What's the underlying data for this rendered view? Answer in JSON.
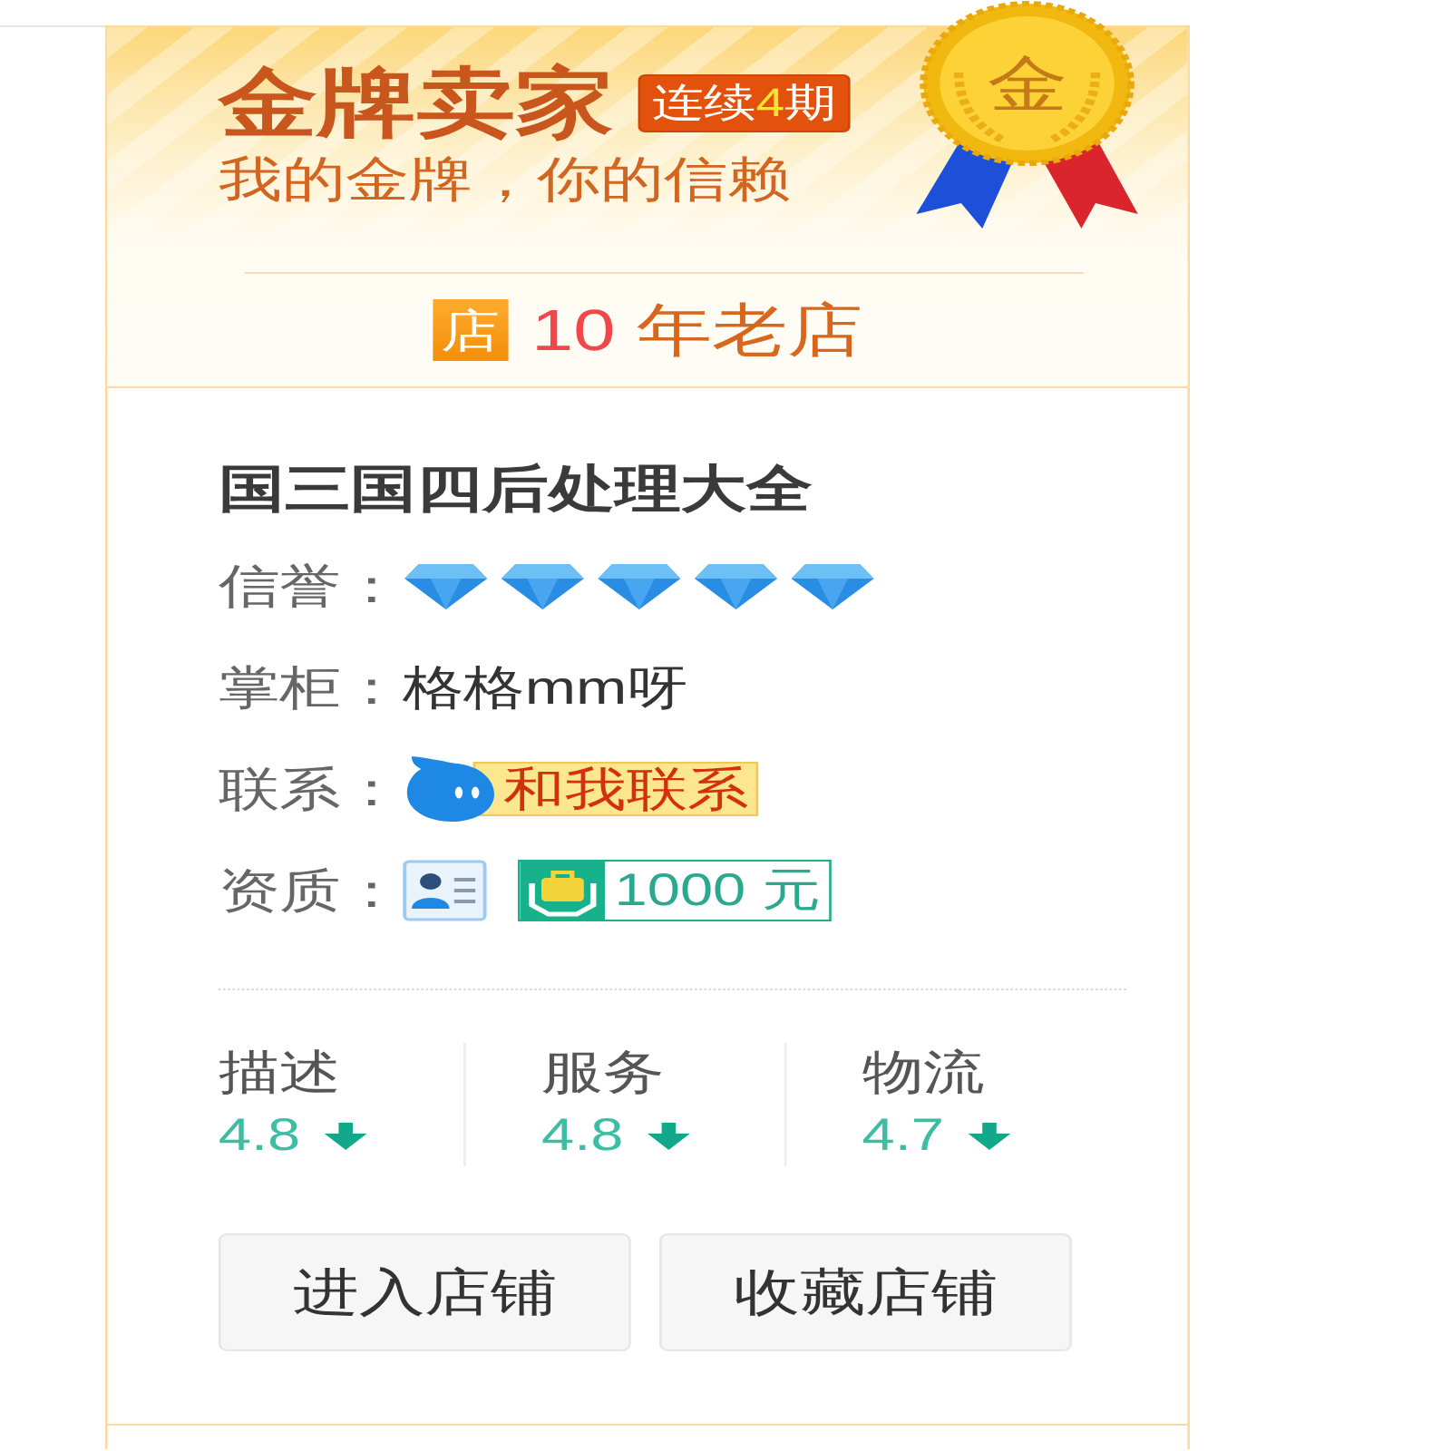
{
  "header": {
    "title": "金牌卖家",
    "streak_badge": {
      "before": "连续",
      "count": "4",
      "after": "期"
    },
    "slogan": "我的金牌，你的信赖",
    "medal": {
      "character": "金"
    }
  },
  "shop_age": {
    "tile": "店",
    "years": "10",
    "unit": "年老店"
  },
  "shop": {
    "name": "国三国四后处理大全",
    "rows": [
      {
        "kind": "rating",
        "label": "信誉：",
        "stars": 5
      },
      {
        "kind": "text",
        "label": "掌柜：",
        "value": "格格mm呀"
      },
      {
        "kind": "contact",
        "label": "联系：",
        "button": "和我联系"
      },
      {
        "kind": "credentials",
        "label": "资质：",
        "deposit": "1000 元"
      }
    ]
  },
  "scores": [
    {
      "kind": "down",
      "label": "描述",
      "value": "4.8"
    },
    {
      "kind": "down",
      "label": "服务",
      "value": "4.8"
    },
    {
      "kind": "down",
      "label": "物流",
      "value": "4.7"
    }
  ],
  "buttons": [
    {
      "label": "进入店铺"
    },
    {
      "label": "收藏店铺"
    }
  ]
}
